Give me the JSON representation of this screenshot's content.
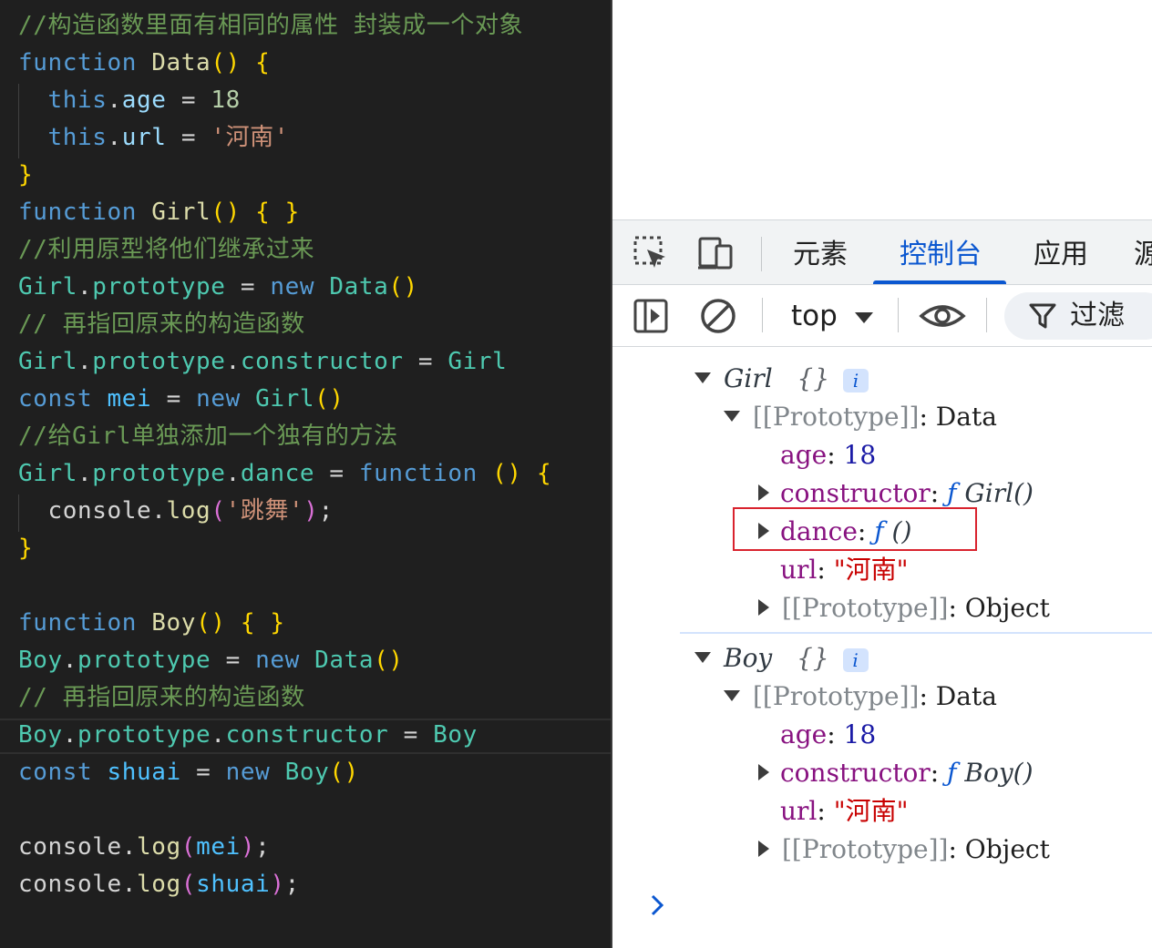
{
  "editor": {
    "lines": [
      [
        [
          "c",
          "//构造函数里面有相同的属性 封装成一个对象"
        ]
      ],
      [
        [
          "k",
          "function"
        ],
        [
          "o",
          " "
        ],
        [
          "m",
          "Data"
        ],
        [
          "b",
          "()"
        ],
        [
          "o",
          " "
        ],
        [
          "b",
          "{"
        ]
      ],
      [
        [
          "o",
          "  "
        ],
        [
          "k",
          "this"
        ],
        [
          "o",
          "."
        ],
        [
          "p",
          "age"
        ],
        [
          "o",
          " = "
        ],
        [
          "n",
          "18"
        ]
      ],
      [
        [
          "o",
          "  "
        ],
        [
          "k",
          "this"
        ],
        [
          "o",
          "."
        ],
        [
          "p",
          "url"
        ],
        [
          "o",
          " = "
        ],
        [
          "s",
          "'河南'"
        ]
      ],
      [
        [
          "b",
          "}"
        ]
      ],
      [
        [
          "k",
          "function"
        ],
        [
          "o",
          " "
        ],
        [
          "m",
          "Girl"
        ],
        [
          "b",
          "()"
        ],
        [
          "o",
          " "
        ],
        [
          "b",
          "{ }"
        ]
      ],
      [
        [
          "c",
          "//利用原型将他们继承过来"
        ]
      ],
      [
        [
          "f",
          "Girl"
        ],
        [
          "o",
          "."
        ],
        [
          "f",
          "prototype"
        ],
        [
          "o",
          " = "
        ],
        [
          "k",
          "new"
        ],
        [
          "o",
          " "
        ],
        [
          "f",
          "Data"
        ],
        [
          "b",
          "()"
        ]
      ],
      [
        [
          "c",
          "// 再指回原来的构造函数"
        ]
      ],
      [
        [
          "f",
          "Girl"
        ],
        [
          "o",
          "."
        ],
        [
          "f",
          "prototype"
        ],
        [
          "o",
          "."
        ],
        [
          "f",
          "constructor"
        ],
        [
          "o",
          " = "
        ],
        [
          "f",
          "Girl"
        ]
      ],
      [
        [
          "k",
          "const"
        ],
        [
          "o",
          " "
        ],
        [
          "v",
          "mei"
        ],
        [
          "o",
          " = "
        ],
        [
          "k",
          "new"
        ],
        [
          "o",
          " "
        ],
        [
          "f",
          "Girl"
        ],
        [
          "b",
          "()"
        ]
      ],
      [
        [
          "c",
          "//给Girl单独添加一个独有的方法"
        ]
      ],
      [
        [
          "f",
          "Girl"
        ],
        [
          "o",
          "."
        ],
        [
          "f",
          "prototype"
        ],
        [
          "o",
          "."
        ],
        [
          "f",
          "dance"
        ],
        [
          "o",
          " = "
        ],
        [
          "k",
          "function"
        ],
        [
          "o",
          " "
        ],
        [
          "b",
          "()"
        ],
        [
          "o",
          " "
        ],
        [
          "b",
          "{"
        ]
      ],
      [
        [
          "o",
          "  console."
        ],
        [
          "m",
          "log"
        ],
        [
          "b2",
          "("
        ],
        [
          "s",
          "'跳舞'"
        ],
        [
          "b2",
          ")"
        ],
        [
          "o",
          ";"
        ]
      ],
      [
        [
          "b",
          "}"
        ]
      ],
      [],
      [
        [
          "k",
          "function"
        ],
        [
          "o",
          " "
        ],
        [
          "m",
          "Boy"
        ],
        [
          "b",
          "()"
        ],
        [
          "o",
          " "
        ],
        [
          "b",
          "{ }"
        ]
      ],
      [
        [
          "f",
          "Boy"
        ],
        [
          "o",
          "."
        ],
        [
          "f",
          "prototype"
        ],
        [
          "o",
          " = "
        ],
        [
          "k",
          "new"
        ],
        [
          "o",
          " "
        ],
        [
          "f",
          "Data"
        ],
        [
          "b",
          "()"
        ]
      ],
      [
        [
          "c",
          "// 再指回原来的构造函数"
        ]
      ],
      [
        [
          "f",
          "Boy"
        ],
        [
          "o",
          "."
        ],
        [
          "f",
          "prototype"
        ],
        [
          "o",
          "."
        ],
        [
          "f",
          "constructor"
        ],
        [
          "o",
          " = "
        ],
        [
          "f",
          "Boy"
        ]
      ],
      [
        [
          "k",
          "const"
        ],
        [
          "o",
          " "
        ],
        [
          "v",
          "shuai"
        ],
        [
          "o",
          " = "
        ],
        [
          "k",
          "new"
        ],
        [
          "o",
          " "
        ],
        [
          "f",
          "Boy"
        ],
        [
          "b",
          "()"
        ]
      ],
      [],
      [
        [
          "o",
          "console."
        ],
        [
          "m",
          "log"
        ],
        [
          "b2",
          "("
        ],
        [
          "v",
          "mei"
        ],
        [
          "b2",
          ")"
        ],
        [
          "o",
          ";"
        ]
      ],
      [
        [
          "o",
          "console."
        ],
        [
          "m",
          "log"
        ],
        [
          "b2",
          "("
        ],
        [
          "v",
          "shuai"
        ],
        [
          "b2",
          ")"
        ],
        [
          "o",
          ";"
        ]
      ]
    ]
  },
  "devtools": {
    "tabs": [
      "元素",
      "控制台",
      "应用",
      "源"
    ],
    "active_tab": "控制台",
    "context": "top",
    "filter_label": "过滤"
  },
  "console": {
    "girl": {
      "name": "Girl",
      "braces": "{}",
      "badge": "i",
      "proto_label": "[[Prototype]]",
      "proto_value": "Data",
      "age_key": "age",
      "age_value": "18",
      "constructor_key": "constructor",
      "constructor_f": "ƒ",
      "constructor_sig": "Girl()",
      "dance_key": "dance",
      "dance_f": "ƒ",
      "dance_sig": "()",
      "url_key": "url",
      "url_value": "\"河南\"",
      "inner_proto_label": "[[Prototype]]",
      "inner_proto_value": "Object"
    },
    "boy": {
      "name": "Boy",
      "braces": "{}",
      "badge": "i",
      "proto_label": "[[Prototype]]",
      "proto_value": "Data",
      "age_key": "age",
      "age_value": "18",
      "constructor_key": "constructor",
      "constructor_f": "ƒ",
      "constructor_sig": "Boy()",
      "url_key": "url",
      "url_value": "\"河南\"",
      "inner_proto_label": "[[Prototype]]",
      "inner_proto_value": "Object"
    }
  }
}
